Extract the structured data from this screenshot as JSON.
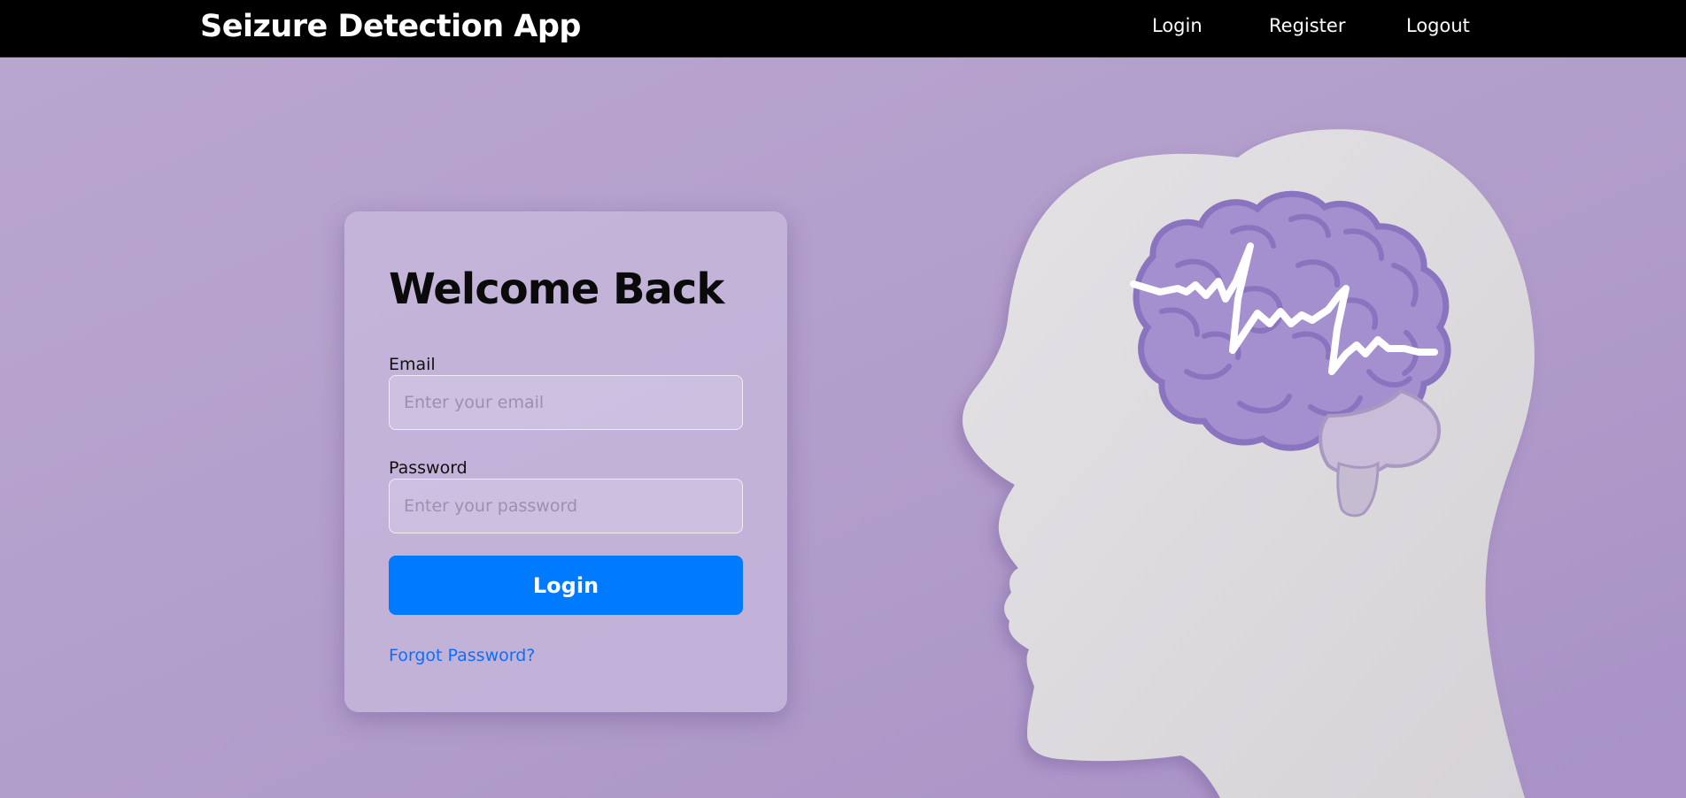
{
  "navbar": {
    "brand": "Seizure Detection App",
    "links": [
      {
        "label": "Login"
      },
      {
        "label": "Register"
      },
      {
        "label": "Logout"
      }
    ]
  },
  "login_card": {
    "title": "Welcome Back",
    "email_label": "Email",
    "email_placeholder": "Enter your email",
    "email_value": "",
    "password_label": "Password",
    "password_placeholder": "Enter your password",
    "password_value": "",
    "submit_label": "Login",
    "forgot_label": "Forgot Password?"
  },
  "hero_image": {
    "icon": "head-profile-brain-eeg-illustration"
  },
  "colors": {
    "navbar_bg": "#000000",
    "page_bg": "#b29fca",
    "primary_button": "#007bff",
    "link": "#0d6efd",
    "brain": "#9d86c8",
    "head": "#dad7da"
  }
}
